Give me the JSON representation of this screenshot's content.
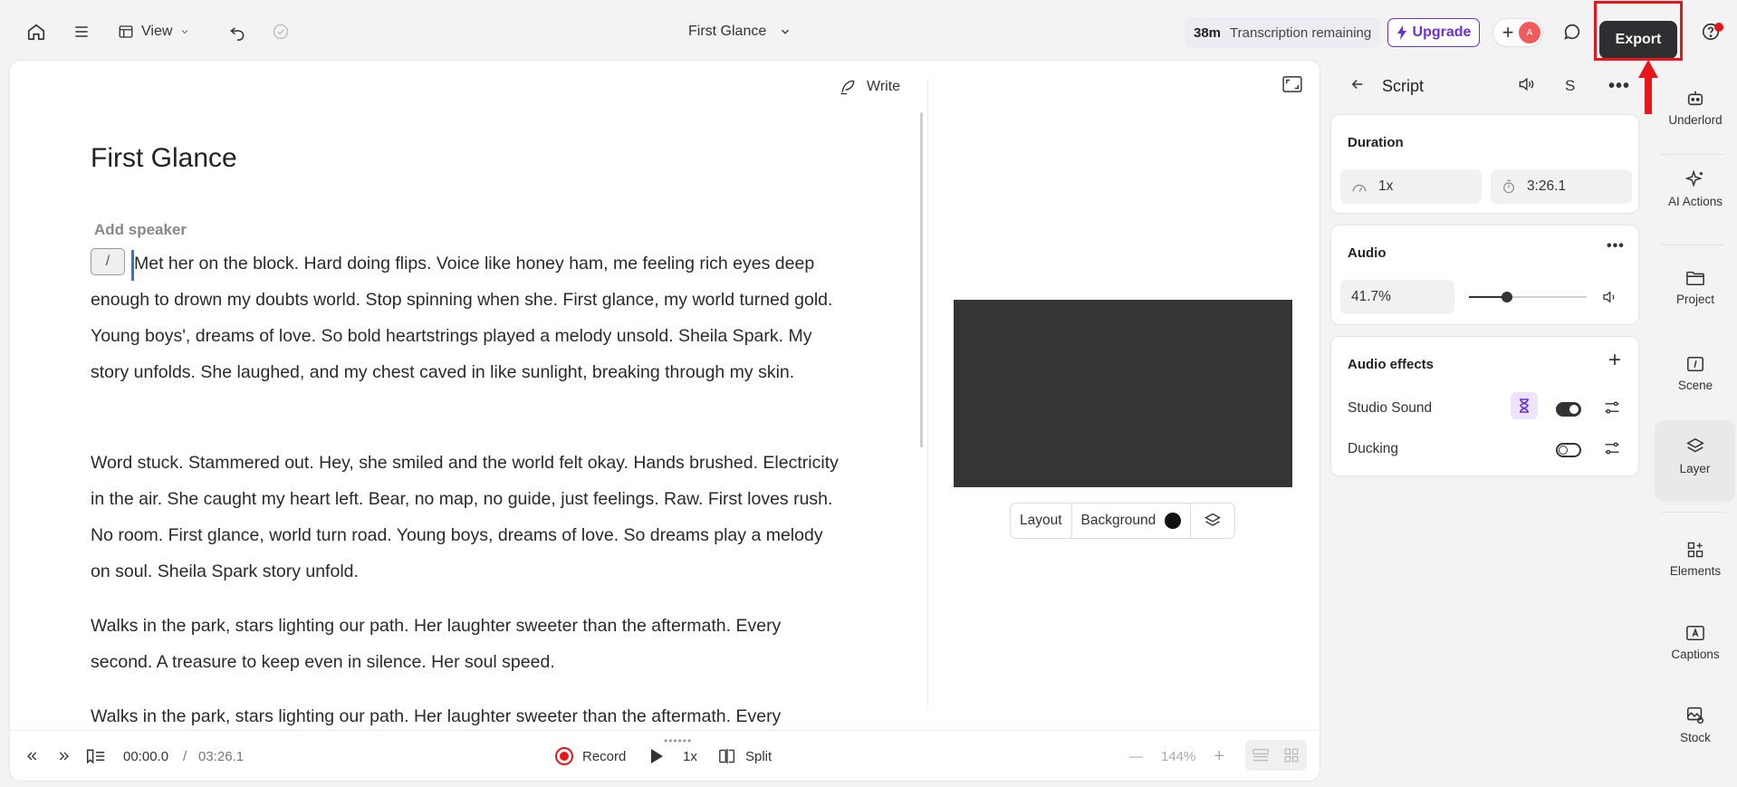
{
  "topbar": {
    "view_label": "View",
    "project_title": "First Glance",
    "transcription_minutes": "38m",
    "transcription_text": "Transcription remaining",
    "upgrade_label": "Upgrade",
    "avatar_initial": "A",
    "export_label": "Export"
  },
  "editor": {
    "write_label": "Write",
    "doc_title": "First Glance",
    "add_speaker": "Add speaker",
    "slash": "/",
    "paragraphs": [
      "Met her on the block. Hard doing flips. Voice like honey ham, me feeling rich eyes deep enough to drown my doubts world. Stop spinning when she. First glance, my world turned gold. Young boys', dreams of love. So bold heartstrings played a melody unsold. Sheila Spark. My story unfolds. She laughed, and my chest caved in like sunlight, breaking through my skin.",
      "Word stuck. Stammered out. Hey, she smiled and the world felt okay. Hands brushed. Electricity in the air. She caught my heart left. Bear, no map, no guide, just feelings. Raw. First loves rush. No room. First glance, world turn road. Young boys, dreams of love. So dreams play a melody on soul. Sheila Spark story unfold.",
      "Walks in the park, stars lighting our path. Her laughter sweeter than the aftermath. Every second. A treasure to keep even in silence. Her soul speed.",
      "Walks in the park, stars lighting our path. Her laughter sweeter than the aftermath. Every"
    ]
  },
  "preview": {
    "layout_label": "Layout",
    "background_label": "Background",
    "background_color": "#111111"
  },
  "bottombar": {
    "time_current": "00:00.0",
    "time_sep": "/",
    "time_total": "03:26.1",
    "record_label": "Record",
    "speed_label": "1x",
    "split_label": "Split",
    "zoom_minus": "—",
    "zoom_level": "144%",
    "zoom_plus": "+"
  },
  "properties": {
    "title": "Script",
    "speaker_letter": "S",
    "duration": {
      "title": "Duration",
      "speed": "1x",
      "length": "3:26.1"
    },
    "audio": {
      "title": "Audio",
      "volume": "41.7%",
      "volume_fraction": 0.32
    },
    "effects": {
      "title": "Audio effects",
      "items": [
        {
          "label": "Studio Sound",
          "enabled": true
        },
        {
          "label": "Ducking",
          "enabled": false
        }
      ]
    }
  },
  "rail": {
    "items": [
      {
        "label": "Underlord",
        "icon": "robot-icon"
      },
      {
        "label": "AI Actions",
        "icon": "sparkle-icon"
      },
      {
        "label": "Project",
        "icon": "folder-icon"
      },
      {
        "label": "Scene",
        "icon": "scene-icon"
      },
      {
        "label": "Layer",
        "icon": "layers-icon",
        "active": true
      },
      {
        "label": "Elements",
        "icon": "elements-icon"
      },
      {
        "label": "Captions",
        "icon": "captions-icon"
      },
      {
        "label": "Stock",
        "icon": "stock-icon"
      }
    ]
  },
  "colors": {
    "accent_purple": "#6b2fd6",
    "highlight_red": "#e8161a",
    "export_bg": "#2f2f31"
  }
}
